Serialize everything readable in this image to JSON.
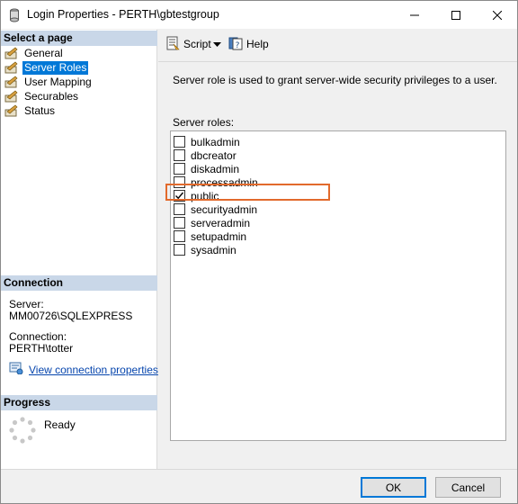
{
  "window": {
    "title": "Login Properties - PERTH\\gbtestgroup"
  },
  "left": {
    "select_page_header": "Select a page",
    "pages": [
      {
        "label": "General",
        "icon": "wrench-icon",
        "selected": false
      },
      {
        "label": "Server Roles",
        "icon": "wrench-icon",
        "selected": true
      },
      {
        "label": "User Mapping",
        "icon": "wrench-icon",
        "selected": false
      },
      {
        "label": "Securables",
        "icon": "wrench-icon",
        "selected": false
      },
      {
        "label": "Status",
        "icon": "wrench-icon",
        "selected": false
      }
    ],
    "connection_header": "Connection",
    "server_label": "Server:",
    "server_value": "MM00726\\SQLEXPRESS",
    "connection_label": "Connection:",
    "connection_value": "PERTH\\totter",
    "view_link": "View connection properties",
    "progress_header": "Progress",
    "progress_status": "Ready"
  },
  "toolbar": {
    "script_label": "Script",
    "help_label": "Help"
  },
  "main": {
    "description": "Server role is used to grant server-wide security privileges to a user.",
    "roles_label": "Server roles:",
    "roles": [
      {
        "name": "bulkadmin",
        "checked": false
      },
      {
        "name": "dbcreator",
        "checked": false
      },
      {
        "name": "diskadmin",
        "checked": false
      },
      {
        "name": "processadmin",
        "checked": false
      },
      {
        "name": "public",
        "checked": true
      },
      {
        "name": "securityadmin",
        "checked": false
      },
      {
        "name": "serveradmin",
        "checked": false
      },
      {
        "name": "setupadmin",
        "checked": false
      },
      {
        "name": "sysadmin",
        "checked": false
      }
    ]
  },
  "buttons": {
    "ok": "OK",
    "cancel": "Cancel"
  },
  "colors": {
    "selection": "#0078d7",
    "section_header": "#c9d7e8",
    "highlight_box": "#e26a2c"
  }
}
